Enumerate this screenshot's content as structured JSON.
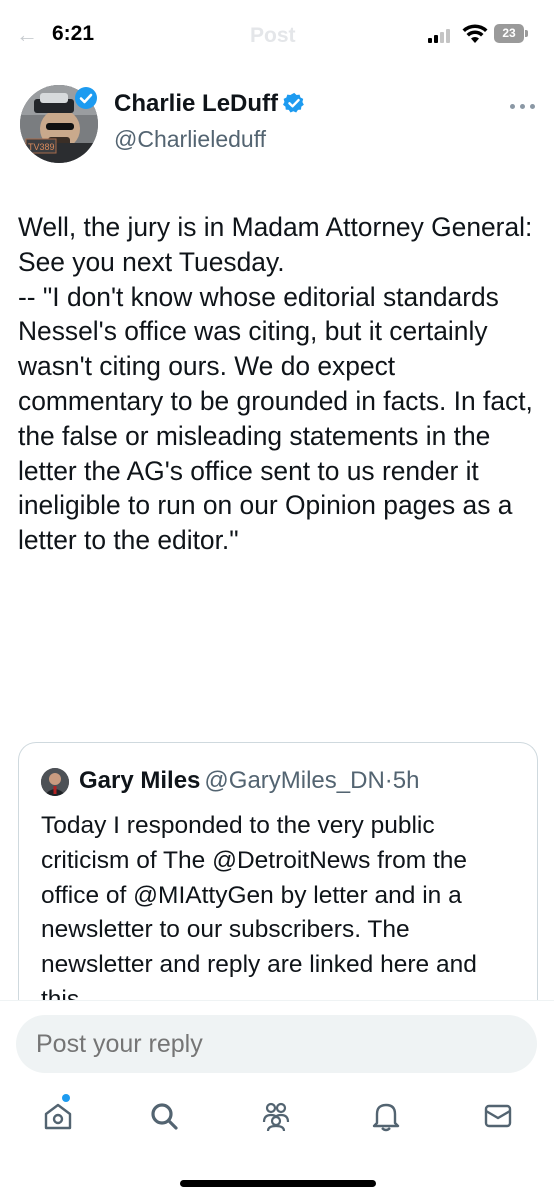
{
  "status_bar": {
    "time": "6:21",
    "battery": "23",
    "ghost_title": "Post"
  },
  "author": {
    "name": "Charlie LeDuff",
    "handle": "@Charlieleduff",
    "avatar_badge_text": "TV389"
  },
  "post": {
    "text": "Well, the jury is in Madam Attorney General:\nSee you next Tuesday.\n --   \"I don't know whose editorial standards Nessel's office was citing, but it certainly wasn't citing ours. We do expect commentary to be grounded in facts. In fact, the false or misleading statements in the letter the AG's office sent to us render it ineligible to run on our Opinion pages as a letter to the editor.\""
  },
  "quote": {
    "name": "Gary Miles",
    "handle": "@GaryMiles_DN",
    "separator": "·",
    "time": "5h",
    "text": "Today I responded to the very public criticism of The @DetroitNews from the office of @MIAttyGen by letter and in a newsletter to our subscribers. The newsletter and reply are linked here and this"
  },
  "reply": {
    "placeholder": "Post your reply"
  },
  "tabs": [
    {
      "icon": "home-icon"
    },
    {
      "icon": "search-icon"
    },
    {
      "icon": "communities-icon"
    },
    {
      "icon": "notifications-icon"
    },
    {
      "icon": "messages-icon"
    }
  ],
  "colors": {
    "verified": "#1d9bf0",
    "text": "#0f1419",
    "secondary": "#536471"
  }
}
